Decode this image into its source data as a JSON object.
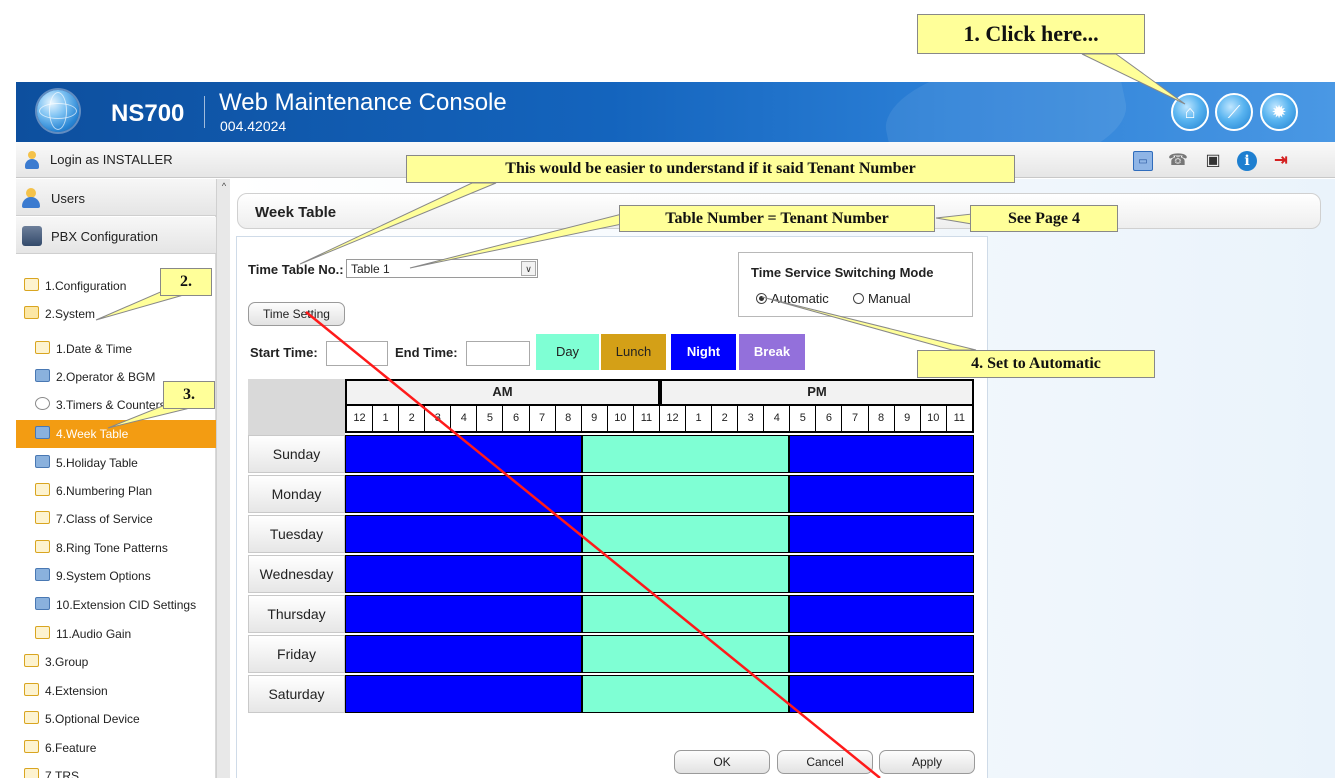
{
  "header": {
    "model": "NS700",
    "app_title": "Web Maintenance Console",
    "version": "004.42024",
    "icons": [
      "home-icon",
      "wrench-icon",
      "gear-icon"
    ]
  },
  "login_bar": {
    "text": "Login as INSTALLER",
    "icons": [
      "window-icon",
      "phone-icon",
      "save-icon",
      "info-icon",
      "logout-icon"
    ]
  },
  "sidebar": {
    "users": "Users",
    "pbx": "PBX Configuration",
    "items": [
      {
        "label": "1.Configuration"
      },
      {
        "label": "2.System"
      },
      {
        "label": "1.Date & Time"
      },
      {
        "label": "2.Operator & BGM"
      },
      {
        "label": "3.Timers & Counters"
      },
      {
        "label": "4.Week Table"
      },
      {
        "label": "5.Holiday Table"
      },
      {
        "label": "6.Numbering Plan"
      },
      {
        "label": "7.Class of Service"
      },
      {
        "label": "8.Ring Tone Patterns"
      },
      {
        "label": "9.System Options"
      },
      {
        "label": "10.Extension CID Settings"
      },
      {
        "label": "11.Audio Gain"
      },
      {
        "label": "3.Group"
      },
      {
        "label": "4.Extension"
      },
      {
        "label": "5.Optional Device"
      },
      {
        "label": "6.Feature"
      },
      {
        "label": "7.TRS"
      }
    ],
    "active_item": "4.Week Table"
  },
  "main": {
    "title": "Week Table",
    "time_table_label": "Time Table No.:",
    "time_table_value": "Table 1",
    "mode_heading": "Time Service Switching Mode",
    "mode_automatic": "Automatic",
    "mode_manual": "Manual",
    "mode_selected": "Automatic",
    "time_setting_button": "Time Setting",
    "start_time_label": "Start Time:",
    "end_time_label": "End Time:",
    "legend": {
      "day": "Day",
      "lunch": "Lunch",
      "night": "Night",
      "break": "Break"
    },
    "colors": {
      "day": "#7fffd4",
      "lunch": "#d4a017",
      "night": "#0000ff",
      "break": "#9370db"
    },
    "am_label": "AM",
    "pm_label": "PM",
    "hours": [
      "12",
      "1",
      "2",
      "3",
      "4",
      "5",
      "6",
      "7",
      "8",
      "9",
      "10",
      "11",
      "12",
      "1",
      "2",
      "3",
      "4",
      "5",
      "6",
      "7",
      "8",
      "9",
      "10",
      "11"
    ],
    "days": [
      "Sunday",
      "Monday",
      "Tuesday",
      "Wednesday",
      "Thursday",
      "Friday",
      "Saturday"
    ],
    "schedule": {
      "day_start": "9 AM",
      "day_end": "5 PM"
    },
    "buttons": {
      "ok": "OK",
      "cancel": "Cancel",
      "apply": "Apply"
    }
  },
  "annotations": {
    "click_here": "1. Click here...",
    "step2": "2.",
    "step3": "3.",
    "tenant_note": "This would be easier to understand if it said Tenant Number",
    "table_number": "Table Number = Tenant Number",
    "see_page": "See Page 4",
    "set_automatic": "4. Set to Automatic"
  }
}
